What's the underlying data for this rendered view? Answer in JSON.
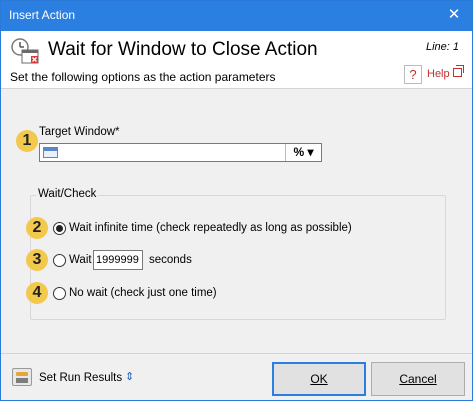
{
  "window": {
    "title": "Insert Action",
    "close_glyph": "✕"
  },
  "header": {
    "title": "Wait for Window to Close Action",
    "line": "Line: 1",
    "subtitle": "Set the following options as the action parameters",
    "help_label": "Help"
  },
  "target": {
    "badge": "1",
    "label": "Target Window*",
    "value": "",
    "variable_button": "% ▾"
  },
  "waitcheck": {
    "title": "Wait/Check",
    "options": [
      {
        "badge": "2",
        "label": "Wait infinite time (check repeatedly as long as possible)",
        "selected": true
      },
      {
        "badge": "3",
        "label": "Wait",
        "selected": false,
        "value": "1999999",
        "unit": "seconds"
      },
      {
        "badge": "4",
        "label": "No wait (check just one time)",
        "selected": false
      }
    ]
  },
  "footer": {
    "set_run_results": "Set Run Results",
    "expand_glyph": "⇕",
    "ok": "OK",
    "cancel": "Cancel"
  },
  "colors": {
    "titlebar": "#2b7fe0",
    "badge": "#f2c94c",
    "help": "#c23030"
  }
}
